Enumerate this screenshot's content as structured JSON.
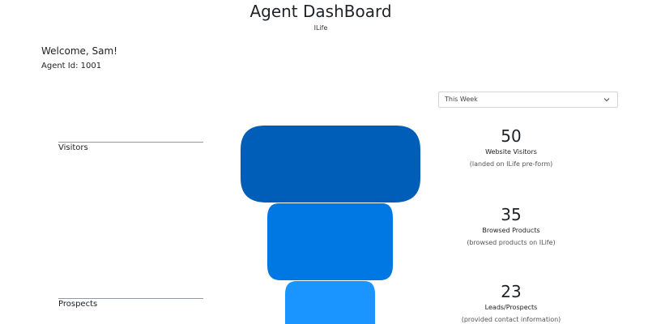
{
  "header": {
    "title": "Agent DashBoard",
    "subtitle": "ILife"
  },
  "user": {
    "welcome": "Welcome, Sam!",
    "agent_id": "Agent Id: 1001"
  },
  "period_select": {
    "selected": "This Week",
    "icon": "chevron-down-icon"
  },
  "stage_labels": [
    "Visitors",
    "Prospects"
  ],
  "funnel": [
    {
      "value": "50",
      "name": "Website Visitors",
      "description": "(landed on ILife pre-form)",
      "color": "#005eb8"
    },
    {
      "value": "35",
      "name": "Browsed Products",
      "description": "(browsed products on ILife)",
      "color": "#0078e4"
    },
    {
      "value": "23",
      "name": "Leads/Prospects",
      "description": "(provided contact information)",
      "color": "#1a94ff"
    }
  ]
}
